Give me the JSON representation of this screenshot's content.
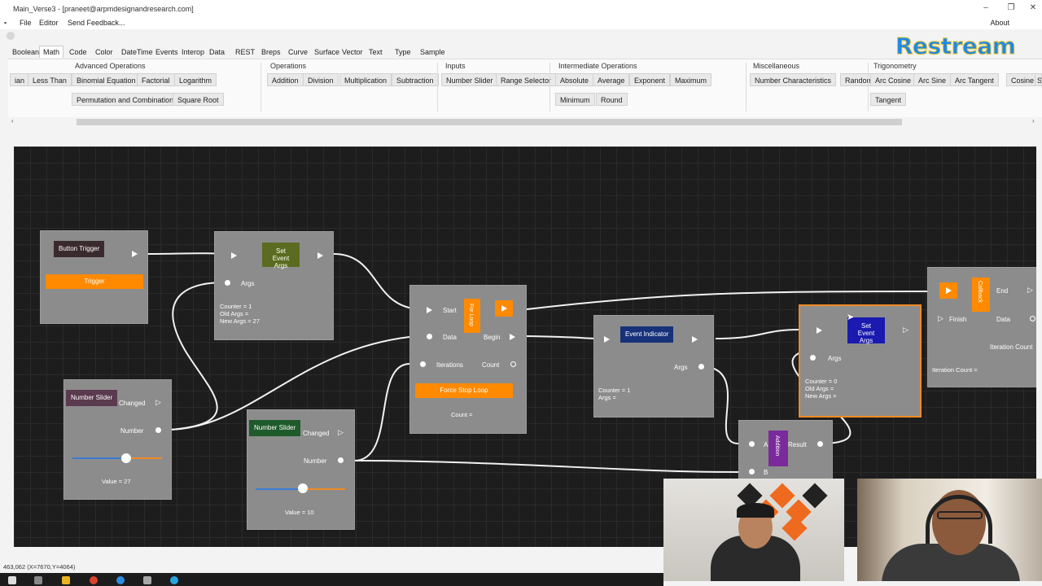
{
  "window": {
    "title": "Main_Verse3 - [praneet@arpmdesignandresearch.com]"
  },
  "menu": {
    "items": [
      "File",
      "Editor",
      "Send Feedback..."
    ],
    "about": "About"
  },
  "overlay": {
    "restream": "Restream"
  },
  "tabs": [
    "Boolean",
    "Math",
    "Code",
    "Color",
    "DateTime",
    "Events",
    "Interop",
    "Data",
    "REST",
    "Breps",
    "Curve",
    "Surface",
    "Vector",
    "Text",
    "Type",
    "Sample"
  ],
  "ribbon": {
    "groups": [
      {
        "title": "Advanced Operations",
        "buttons": [
          "ian",
          "Less Than",
          "Binomial Equation",
          "Factorial",
          "Logarithm",
          "Permutation and Combination",
          "Square Root"
        ]
      },
      {
        "title": "Operations",
        "buttons": [
          "Addition",
          "Division",
          "Multiplication",
          "Subtraction"
        ]
      },
      {
        "title": "Inputs",
        "buttons": [
          "Number Slider",
          "Range Selector"
        ]
      },
      {
        "title": "Intermediate Operations",
        "buttons": [
          "Absolute",
          "Average",
          "Exponent",
          "Maximum",
          "Minimum",
          "Round"
        ]
      },
      {
        "title": "Miscellaneous",
        "buttons": [
          "Number Characteristics",
          "Random"
        ]
      },
      {
        "title": "Trigonometry",
        "buttons": [
          "Arc Cosine",
          "Arc Sine",
          "Arc Tangent",
          "Cosine",
          "Si",
          "Tangent"
        ]
      }
    ]
  },
  "nodes": {
    "button_trigger": {
      "title": "Button Trigger",
      "button": "Trigger"
    },
    "set_event_args_1": {
      "title": "Set Event Args",
      "args": "Args",
      "info": "Counter = 1\nOld Args =\nNew Args = 27"
    },
    "number_slider_1": {
      "title": "Number Slider",
      "changed": "Changed",
      "number": "Number",
      "value_text": "Value = 27",
      "value_fraction": 0.6
    },
    "number_slider_2": {
      "title": "Number Slider",
      "changed": "Changed",
      "number": "Number",
      "value_text": "Value = 10",
      "value_fraction": 0.53
    },
    "for_loop": {
      "title": "For Loop",
      "start": "Start",
      "data": "Data",
      "begin": "Begin",
      "iterations": "Iterations",
      "count": "Count",
      "button": "Force Stop Loop",
      "count_text": "Count ="
    },
    "event_indicator": {
      "title": "Event Indicator",
      "args": "Args",
      "info": "Counter = 1\nArgs ="
    },
    "set_event_args_2": {
      "title": "Set Event Args",
      "args": "Args",
      "info": "Counter = 0\nOld Args =\nNew Args ="
    },
    "addition": {
      "title": "Addition",
      "a": "A",
      "b": "B",
      "result": "Result"
    },
    "callback": {
      "title": "Callback",
      "end": "End",
      "finish": "Finish",
      "data": "Data",
      "iteration_count": "Iteration Count",
      "iteration_text": "Iteration Count ="
    }
  },
  "status": {
    "coords": "463,062   (X=7670,Y=4064)"
  },
  "colors": {
    "canvas": "#1d1d1d",
    "node": "#8c8c8c",
    "accent_orange": "#ff8a00",
    "selected_border": "#f08a24"
  }
}
